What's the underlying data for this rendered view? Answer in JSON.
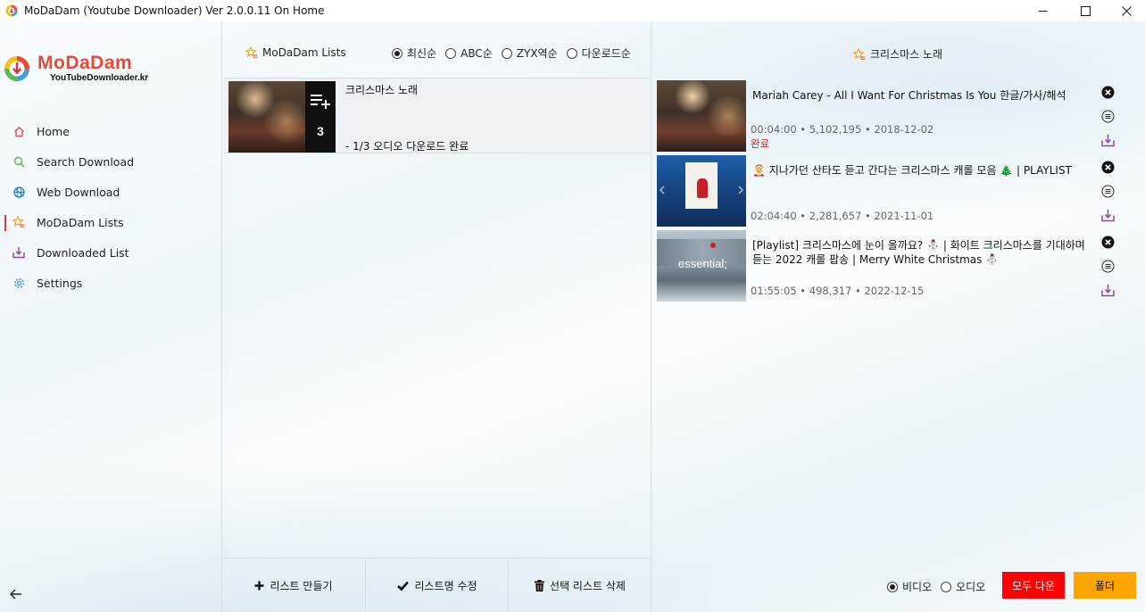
{
  "window": {
    "title": "MoDaDam (Youtube Downloader) Ver 2.0.0.11 On Home"
  },
  "logo": {
    "brand": "MoDaDam",
    "sub": "YouTubeDownloader.kr"
  },
  "sidebar": {
    "items": [
      {
        "label": "Home",
        "icon": "home-icon",
        "color": "#e04848"
      },
      {
        "label": "Search Download",
        "icon": "search-icon",
        "color": "#6ab04c"
      },
      {
        "label": "Web Download",
        "icon": "globe-icon",
        "color": "#2a7fc0"
      },
      {
        "label": "MoDaDam Lists",
        "icon": "star-list-icon",
        "color": "#f0a020",
        "active": true
      },
      {
        "label": "Downloaded List",
        "icon": "download-tray-icon",
        "color": "#8e44ad"
      },
      {
        "label": "Settings",
        "icon": "gear-icon",
        "color": "#2aa0d8"
      }
    ]
  },
  "lists_panel": {
    "title": "MoDaDam Lists",
    "sort_options": [
      "최신순",
      "ABC순",
      "ZYX역순",
      "다운로드순"
    ],
    "selected_sort": "최신순",
    "lists": [
      {
        "name": "크리스마스 노래",
        "count": "3",
        "status": "- 1/3 오디오 다운로드 완료"
      }
    ],
    "buttons": {
      "create": "리스트 만들기",
      "rename": "리스트명 수정",
      "delete": "선택 리스트 삭제"
    }
  },
  "videos_panel": {
    "title": "크리스마스 노래",
    "videos": [
      {
        "title": "Mariah Carey - All I Want For Christmas Is You 한글/가사/해석",
        "duration": "00:04:00",
        "views": "5,102,195",
        "date": "2018-12-02",
        "status": "완료"
      },
      {
        "title": "🤶 지나가던 산타도 듣고 간다는 크리스마스 캐롤 모음 🎄 | PLAYLIST",
        "duration": "02:04:40",
        "views": "2,281,657",
        "date": "2021-11-01",
        "status": ""
      },
      {
        "title": "[Playlist] 크리스마스에 눈이 올까요? ⛄ | 화이트 크리스마스를 기대하며 듣는 2022 캐롤 팝송 | Merry White Christmas ⛄",
        "duration": "01:55:05",
        "views": "498,317",
        "date": "2022-12-15",
        "status": ""
      }
    ],
    "format_options": [
      "비디오",
      "오디오"
    ],
    "selected_format": "비디오",
    "download_all": "모두 다운",
    "folder": "폴더"
  },
  "thumb_text": {
    "essential": "essential;"
  }
}
